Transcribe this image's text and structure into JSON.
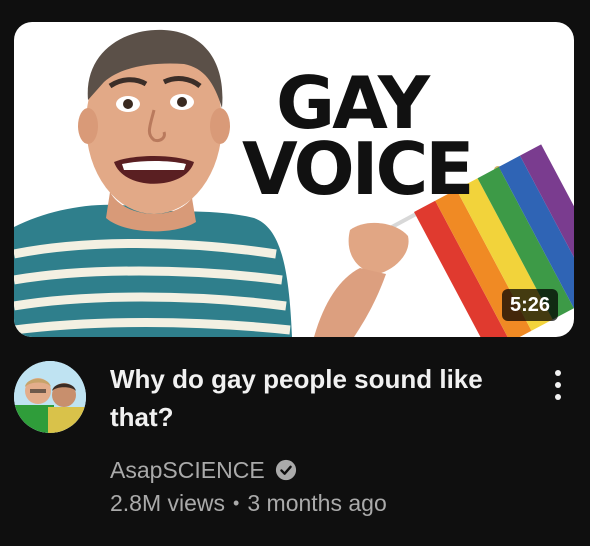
{
  "video": {
    "thumbnail_text_line1": "GAY",
    "thumbnail_text_line2": "VOICE",
    "duration": "5:26",
    "title": "Why do gay people sound like that?",
    "channel": "AsapSCIENCE",
    "views": "2.8M views",
    "separator": "•",
    "age": "3 months ago"
  },
  "icons": {
    "verified": "verified-check-icon",
    "more": "more-vertical-icon"
  },
  "colors": {
    "background": "#0f0f0f",
    "primary_text": "#f1f1f1",
    "secondary_text": "#aaaaaa",
    "thumbnail_bg": "#ffffff"
  }
}
